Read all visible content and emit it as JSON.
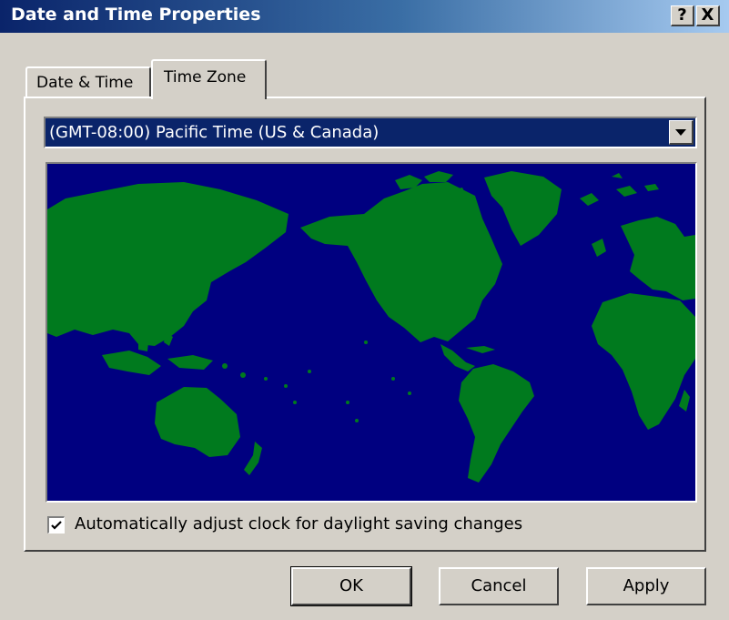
{
  "window": {
    "title": "Date and Time Properties",
    "help_glyph": "?",
    "close_glyph": "X"
  },
  "tabs": [
    {
      "label": "Date & Time",
      "selected": false
    },
    {
      "label": "Time Zone",
      "selected": true
    }
  ],
  "timezone": {
    "selected": "(GMT-08:00) Pacific Time (US & Canada)"
  },
  "map": {
    "ocean_color": "#000080",
    "land_color": "#007a1e"
  },
  "dst": {
    "label": "Automatically adjust clock for daylight saving changes",
    "checked": true
  },
  "buttons": {
    "ok": "OK",
    "cancel": "Cancel",
    "apply": "Apply"
  },
  "colors": {
    "titlebar_start": "#0a246a",
    "titlebar_end": "#a6caf0",
    "face": "#d4d0c8"
  }
}
